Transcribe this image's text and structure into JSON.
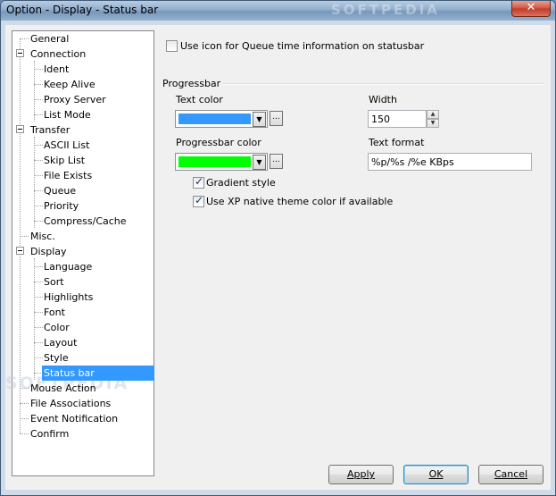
{
  "window": {
    "title": "Option - Display - Status bar",
    "close_glyph": "✕",
    "watermark": "SOFTPEDIA",
    "watermark_left": "SOFTPEDIA"
  },
  "tree": {
    "items": [
      {
        "label": "General"
      },
      {
        "label": "Connection"
      },
      {
        "label": "Ident"
      },
      {
        "label": "Keep Alive"
      },
      {
        "label": "Proxy Server"
      },
      {
        "label": "List Mode"
      },
      {
        "label": "Transfer"
      },
      {
        "label": "ASCII List"
      },
      {
        "label": "Skip List"
      },
      {
        "label": "File Exists"
      },
      {
        "label": "Queue"
      },
      {
        "label": "Priority"
      },
      {
        "label": "Compress/Cache"
      },
      {
        "label": "Misc."
      },
      {
        "label": "Display"
      },
      {
        "label": "Language"
      },
      {
        "label": "Sort"
      },
      {
        "label": "Highlights"
      },
      {
        "label": "Font"
      },
      {
        "label": "Color"
      },
      {
        "label": "Layout"
      },
      {
        "label": "Style"
      },
      {
        "label": "Status bar"
      },
      {
        "label": "Mouse Action"
      },
      {
        "label": "File Associations"
      },
      {
        "label": "Event Notification"
      },
      {
        "label": "Confirm"
      }
    ],
    "selected": "Status bar"
  },
  "settings": {
    "queue_icon_label": "Use icon for Queue time information on statusbar",
    "queue_icon_checked": false,
    "group_label": "Progressbar",
    "text_color_label": "Text color",
    "text_color": "#3399ff",
    "width_label": "Width",
    "width_value": "150",
    "progress_color_label": "Progressbar color",
    "progress_color": "#00ff00",
    "text_format_label": "Text format",
    "text_format_value": "%p/%s /%e KBps",
    "gradient_label": "Gradient style",
    "gradient_checked": true,
    "xp_theme_label": "Use XP native theme color if available",
    "xp_theme_checked": true,
    "dropdown_glyph": "▼",
    "dots_glyph": "...",
    "spin_up": "▲",
    "spin_down": "▼"
  },
  "buttons": {
    "apply": "Apply",
    "ok": "OK",
    "cancel": "Cancel"
  }
}
